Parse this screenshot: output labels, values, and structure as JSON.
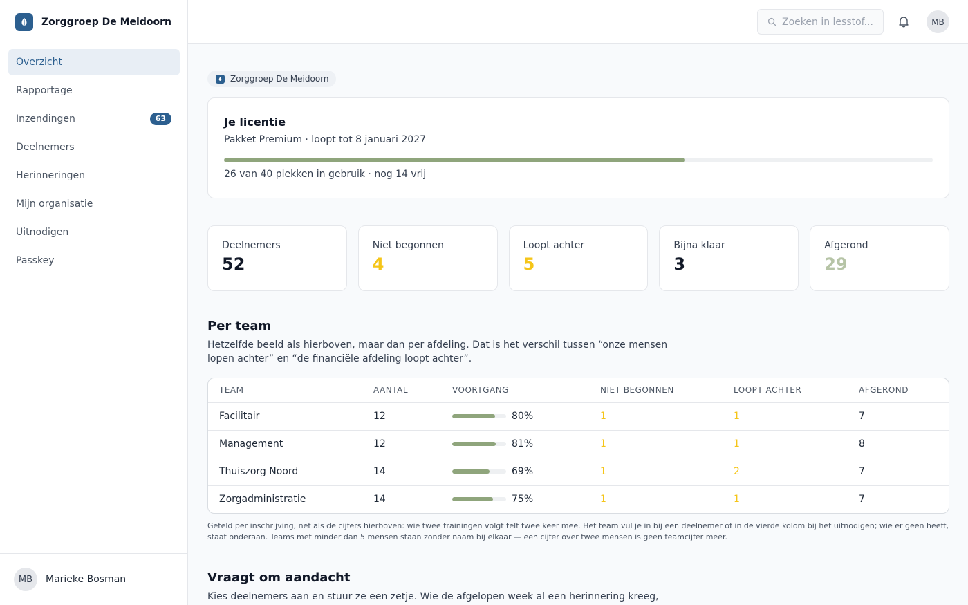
{
  "brand": {
    "name": "Zorggroep De Meidoorn",
    "accent": "#2c5f8f"
  },
  "sidebar": {
    "items": [
      {
        "label": "Overzicht",
        "active": true
      },
      {
        "label": "Rapportage"
      },
      {
        "label": "Inzendingen",
        "badge": "63"
      },
      {
        "label": "Deelnemers"
      },
      {
        "label": "Herinneringen"
      },
      {
        "label": "Mijn organisatie"
      },
      {
        "label": "Uitnodigen"
      },
      {
        "label": "Passkey"
      }
    ],
    "user": {
      "initials": "MB",
      "name": "Marieke Bosman"
    }
  },
  "topbar": {
    "search_placeholder": "Zoeken in lesstof...",
    "bell_icon": "bell-icon",
    "user_initials": "MB"
  },
  "org_chip": {
    "label": "Zorggroep De Meidoorn"
  },
  "license": {
    "title": "Je licentie",
    "subtitle": "Pakket Premium · loopt tot 8 januari 2027",
    "used_fraction": 0.65,
    "usage_text": "26 van 40 plekken in gebruik · nog 14 vrij"
  },
  "stats": [
    {
      "label": "Deelnemers",
      "value": "52",
      "color": "#111827"
    },
    {
      "label": "Niet begonnen",
      "value": "4",
      "color": "#f5c518"
    },
    {
      "label": "Loopt achter",
      "value": "5",
      "color": "#f5c518"
    },
    {
      "label": "Bijna klaar",
      "value": "3",
      "color": "#111827"
    },
    {
      "label": "Afgerond",
      "value": "29",
      "color": "#b6c4a6"
    }
  ],
  "per_team": {
    "title": "Per team",
    "description": "Hetzelfde beeld als hierboven, maar dan per afdeling. Dat is het verschil tussen “onze mensen lopen achter” en “de financiële afdeling loopt achter”.",
    "columns": [
      "TEAM",
      "AANTAL",
      "VOORTGANG",
      "NIET BEGONNEN",
      "LOOPT ACHTER",
      "AFGEROND"
    ],
    "rows": [
      {
        "team": "Facilitair",
        "aantal": "12",
        "voortgang": "80%",
        "pct": 80,
        "niet": "1",
        "loopt": "1",
        "afgerond": "7"
      },
      {
        "team": "Management",
        "aantal": "12",
        "voortgang": "81%",
        "pct": 81,
        "niet": "1",
        "loopt": "1",
        "afgerond": "8"
      },
      {
        "team": "Thuiszorg Noord",
        "aantal": "14",
        "voortgang": "69%",
        "pct": 69,
        "niet": "1",
        "loopt": "2",
        "afgerond": "7"
      },
      {
        "team": "Zorgadministratie",
        "aantal": "14",
        "voortgang": "75%",
        "pct": 75,
        "niet": "1",
        "loopt": "1",
        "afgerond": "7"
      }
    ],
    "footnote": "Geteld per inschrijving, net als de cijfers hierboven: wie twee trainingen volgt telt twee keer mee. Het team vul je in bij een deelnemer of in de vierde kolom bij het uitnodigen; wie er geen heeft, staat onderaan. Teams met minder dan 5 mensen staan zonder naam bij elkaar — een cijfer over twee mensen is geen teamcijfer meer."
  },
  "attention": {
    "title": "Vraagt om aandacht",
    "description": "Kies deelnemers aan en stuur ze een zetje. Wie de afgelopen week al een herinnering kreeg,"
  }
}
